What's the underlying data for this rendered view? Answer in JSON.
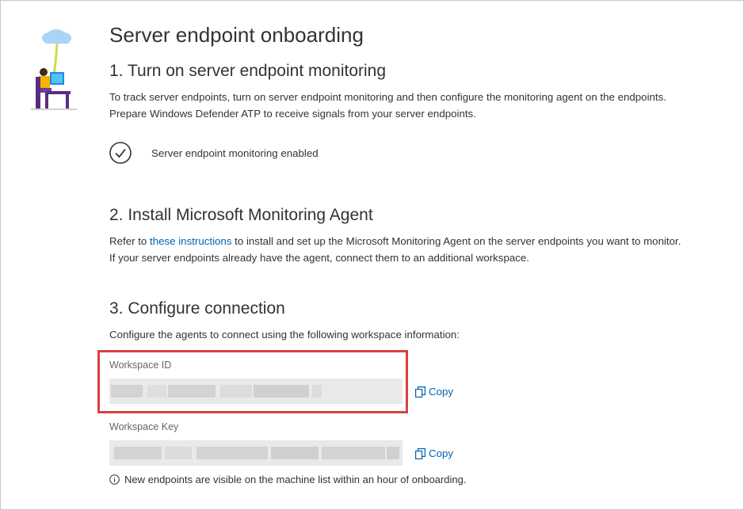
{
  "page": {
    "title": "Server endpoint onboarding"
  },
  "step1": {
    "heading": "1. Turn on server endpoint monitoring",
    "line1": "To track server endpoints, turn on server endpoint monitoring and then configure the monitoring agent on the endpoints.",
    "line2": "Prepare Windows Defender ATP to receive signals from your server endpoints.",
    "status": "Server endpoint monitoring enabled",
    "status_icon": "checkmark-circle-icon"
  },
  "step2": {
    "heading": "2. Install Microsoft Monitoring Agent",
    "line1_before": "Refer to ",
    "link_text": "these instructions",
    "line1_after": " to install and set up the Microsoft Monitoring Agent on the server endpoints you want to monitor.",
    "line2": "If your server endpoints already have the agent, connect them to an additional workspace."
  },
  "step3": {
    "heading": "3. Configure connection",
    "intro": "Configure the agents to connect using the following workspace information:",
    "workspace_id": {
      "label": "Workspace ID",
      "value": "",
      "copy_label": "Copy"
    },
    "workspace_key": {
      "label": "Workspace Key",
      "value": "",
      "copy_label": "Copy"
    },
    "note": "New endpoints are visible on the machine list within an hour of onboarding."
  },
  "colors": {
    "link": "#0063b1",
    "highlight": "#d9413e",
    "text": "#333333"
  }
}
